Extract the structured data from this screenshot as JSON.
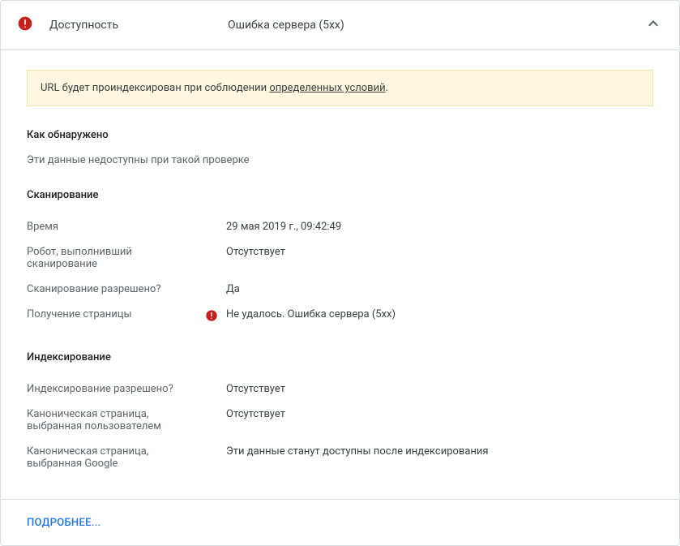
{
  "header": {
    "title": "Доступность",
    "subtitle": "Ошибка сервера (5xx)"
  },
  "banner": {
    "prefix": "URL будет проиндексирован при соблюдении ",
    "link": "определенных условий",
    "suffix": "."
  },
  "sections": {
    "discovery": {
      "title": "Как обнаружено",
      "note": "Эти данные недоступны при такой проверке"
    },
    "crawl": {
      "title": "Сканирование",
      "rows": {
        "time": {
          "label": "Время",
          "value": "29 мая 2019 г., 09:42:49"
        },
        "robot": {
          "label": "Робот, выполнивший сканирование",
          "value": "Отсутствует"
        },
        "allowed": {
          "label": "Сканирование разрешено?",
          "value": "Да"
        },
        "fetch": {
          "label": "Получение страницы",
          "value": "Не удалось. Ошибка сервера (5xx)"
        }
      }
    },
    "indexing": {
      "title": "Индексирование",
      "rows": {
        "allowed": {
          "label": "Индексирование разрешено?",
          "value": "Отсутствует"
        },
        "user_canonical": {
          "label": "Каноническая страница, выбранная пользователем",
          "value": "Отсутствует"
        },
        "google_canonical": {
          "label": "Каноническая страница, выбранная Google",
          "value": "Эти данные станут доступны после индексирования"
        }
      }
    }
  },
  "footer": {
    "more": "Подробнее..."
  }
}
